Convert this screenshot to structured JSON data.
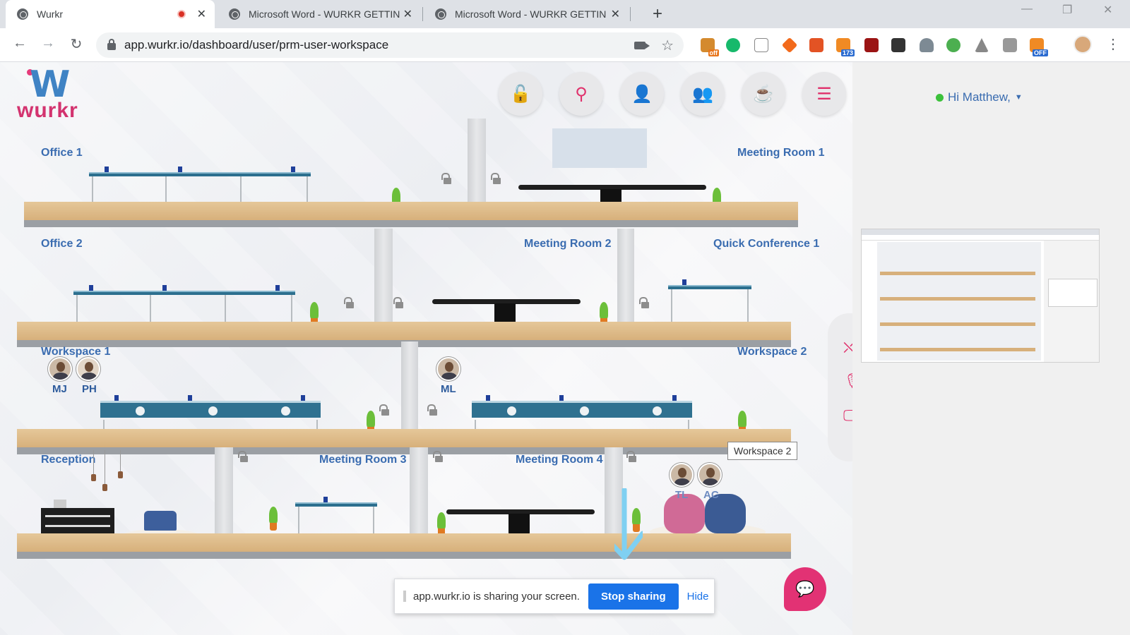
{
  "browser": {
    "tabs": [
      {
        "title": "Wurkr",
        "active": true,
        "recording": true
      },
      {
        "title": "Microsoft Word - WURKR GETTIN",
        "active": false
      },
      {
        "title": "Microsoft Word - WURKR GETTIN",
        "active": false
      }
    ],
    "new_tab_icon": "plus-icon",
    "url": "app.wurkr.io/dashboard/user/prm-user-workspace",
    "extension_badges": {
      "off1": "off",
      "count": "173",
      "off2": "OFF"
    }
  },
  "app": {
    "logo_text": "wurkr",
    "toolbar_icons": [
      "unlock-icon",
      "search-icon",
      "add-user-icon",
      "team-icon",
      "coffee-icon",
      "menu-icon"
    ],
    "rooms": {
      "office1": "Office 1",
      "meeting1": "Meeting Room 1",
      "office2": "Office 2",
      "meeting2": "Meeting Room 2",
      "quick1": "Quick Conference 1",
      "workspace1": "Workspace 1",
      "workspace2": "Workspace 2",
      "reception": "Reception",
      "meeting3": "Meeting Room 3",
      "meeting4": "Meeting Room 4"
    },
    "users": {
      "mj": "MJ",
      "ph": "PH",
      "ml": "ML",
      "tl": "TL",
      "ac": "AC"
    },
    "tooltip": "Workspace 2",
    "share_bar": {
      "message": "app.wurkr.io is sharing your screen.",
      "stop": "Stop sharing",
      "hide": "Hide"
    },
    "media_controls": [
      "camera-off-icon",
      "mic-off-icon",
      "screen-share-icon"
    ],
    "chat_icon": "chat-icon"
  },
  "side": {
    "greeting": "Hi Matthew,",
    "status_color": "#3cc13b"
  },
  "colors": {
    "accent": "#e0306b",
    "label_blue": "#3a6cb0",
    "stop_button": "#1a73e8"
  }
}
